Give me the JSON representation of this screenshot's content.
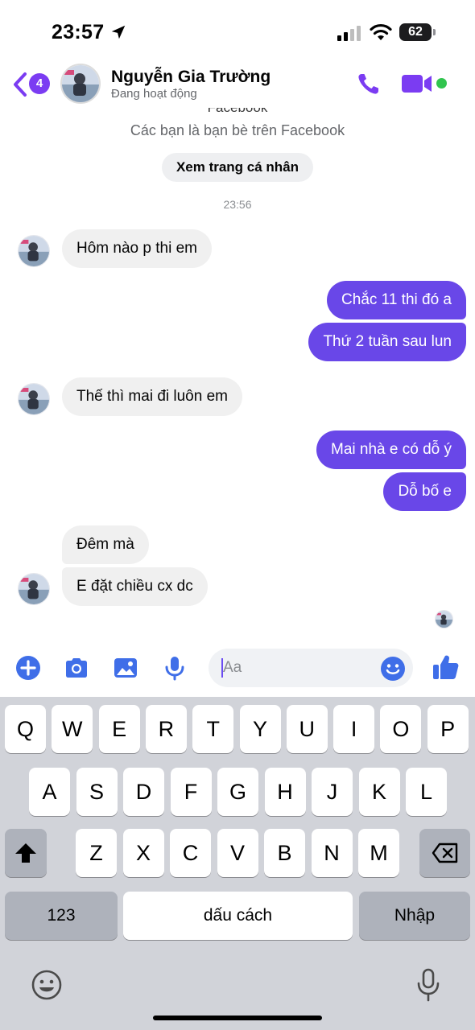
{
  "status_bar": {
    "time": "23:57",
    "battery_percent": "62",
    "icons": [
      "location-arrow-icon",
      "cellular-signal-icon",
      "wifi-icon",
      "battery-icon"
    ]
  },
  "header": {
    "back_badge": "4",
    "contact_name": "Nguyễn Gia Trường",
    "contact_status": "Đang hoạt động",
    "accent_color": "#7b3cf2",
    "online_color": "#31c44f"
  },
  "chat": {
    "cut_off_text": "Facebook",
    "friends_note": "Các bạn là bạn bè trên Facebook",
    "view_profile_label": "Xem trang cá nhân",
    "timestamp": "23:56",
    "messages": [
      {
        "sender": "contact",
        "text": "Hôm nào p thi em"
      },
      {
        "sender": "me",
        "text": "Chắc 11 thi đó a"
      },
      {
        "sender": "me",
        "text": "Thứ 2 tuần sau lun"
      },
      {
        "sender": "contact",
        "text": "Thế thì mai đi luôn em"
      },
      {
        "sender": "me",
        "text": "Mai nhà e có dỗ ý"
      },
      {
        "sender": "me",
        "text": "Dỗ bố e"
      },
      {
        "sender": "contact",
        "text": "Đêm mà"
      },
      {
        "sender": "contact",
        "text": "E đặt chiều cx dc"
      }
    ],
    "outgoing_bubble_color": "#6947e8",
    "incoming_bubble_color": "#f0f0f0"
  },
  "composer": {
    "placeholder": "Aa",
    "value": ""
  },
  "keyboard": {
    "row1": [
      "Q",
      "W",
      "E",
      "R",
      "T",
      "Y",
      "U",
      "I",
      "O",
      "P"
    ],
    "row2": [
      "A",
      "S",
      "D",
      "F",
      "G",
      "H",
      "J",
      "K",
      "L"
    ],
    "row3": [
      "Z",
      "X",
      "C",
      "V",
      "B",
      "N",
      "M"
    ],
    "numbers_key": "123",
    "space_key": "dấu cách",
    "return_key": "Nhập"
  }
}
